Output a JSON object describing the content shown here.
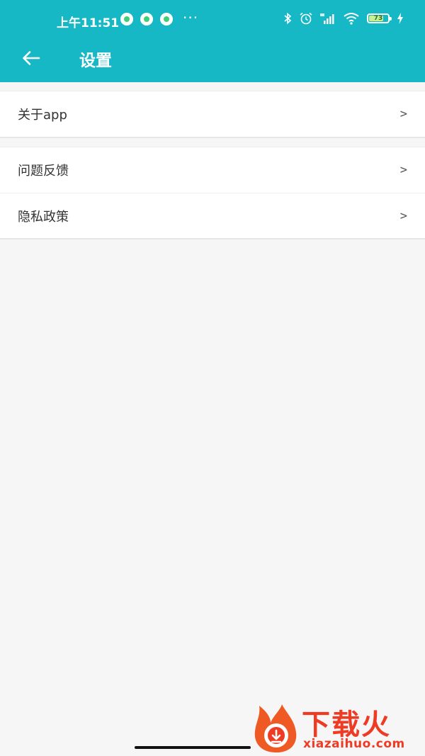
{
  "status_bar": {
    "time": "上午11:51",
    "more": "···",
    "battery_level": "73"
  },
  "header": {
    "title": "设置",
    "back_icon": "arrow-left-icon"
  },
  "settings_groups": [
    {
      "items": [
        {
          "label": "关于app",
          "chevron": ">"
        }
      ]
    },
    {
      "items": [
        {
          "label": "问题反馈",
          "chevron": ">"
        },
        {
          "label": "隐私政策",
          "chevron": ">"
        }
      ]
    }
  ],
  "watermark": {
    "text_zh": "下载火",
    "text_en": "xiazaihuo.com"
  },
  "colors": {
    "accent": "#16b8c6",
    "background": "#f6f6f6",
    "watermark": "#ef3b24"
  }
}
